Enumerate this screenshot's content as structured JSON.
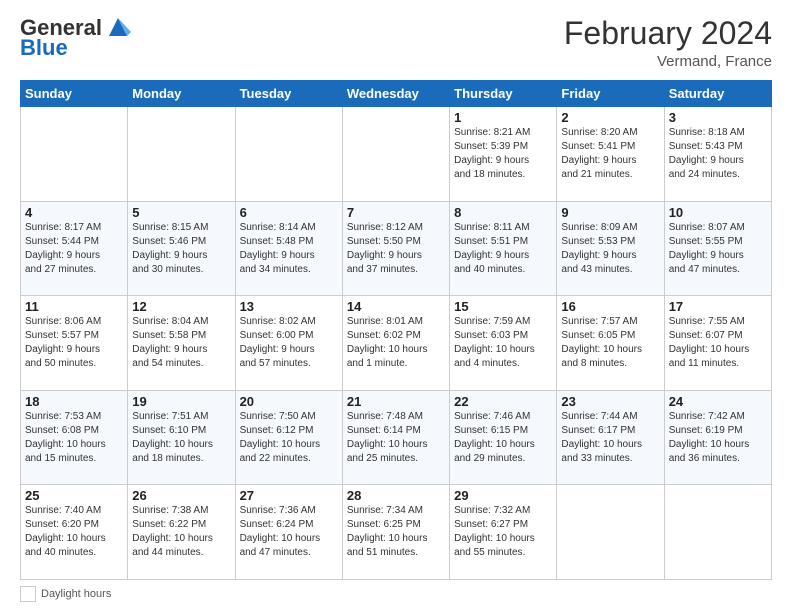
{
  "header": {
    "logo_line1": "General",
    "logo_line2": "Blue",
    "month_title": "February 2024",
    "location": "Vermand, France"
  },
  "days_of_week": [
    "Sunday",
    "Monday",
    "Tuesday",
    "Wednesday",
    "Thursday",
    "Friday",
    "Saturday"
  ],
  "legend_label": "Daylight hours",
  "weeks": [
    [
      {
        "day": "",
        "info": ""
      },
      {
        "day": "",
        "info": ""
      },
      {
        "day": "",
        "info": ""
      },
      {
        "day": "",
        "info": ""
      },
      {
        "day": "1",
        "info": "Sunrise: 8:21 AM\nSunset: 5:39 PM\nDaylight: 9 hours\nand 18 minutes."
      },
      {
        "day": "2",
        "info": "Sunrise: 8:20 AM\nSunset: 5:41 PM\nDaylight: 9 hours\nand 21 minutes."
      },
      {
        "day": "3",
        "info": "Sunrise: 8:18 AM\nSunset: 5:43 PM\nDaylight: 9 hours\nand 24 minutes."
      }
    ],
    [
      {
        "day": "4",
        "info": "Sunrise: 8:17 AM\nSunset: 5:44 PM\nDaylight: 9 hours\nand 27 minutes."
      },
      {
        "day": "5",
        "info": "Sunrise: 8:15 AM\nSunset: 5:46 PM\nDaylight: 9 hours\nand 30 minutes."
      },
      {
        "day": "6",
        "info": "Sunrise: 8:14 AM\nSunset: 5:48 PM\nDaylight: 9 hours\nand 34 minutes."
      },
      {
        "day": "7",
        "info": "Sunrise: 8:12 AM\nSunset: 5:50 PM\nDaylight: 9 hours\nand 37 minutes."
      },
      {
        "day": "8",
        "info": "Sunrise: 8:11 AM\nSunset: 5:51 PM\nDaylight: 9 hours\nand 40 minutes."
      },
      {
        "day": "9",
        "info": "Sunrise: 8:09 AM\nSunset: 5:53 PM\nDaylight: 9 hours\nand 43 minutes."
      },
      {
        "day": "10",
        "info": "Sunrise: 8:07 AM\nSunset: 5:55 PM\nDaylight: 9 hours\nand 47 minutes."
      }
    ],
    [
      {
        "day": "11",
        "info": "Sunrise: 8:06 AM\nSunset: 5:57 PM\nDaylight: 9 hours\nand 50 minutes."
      },
      {
        "day": "12",
        "info": "Sunrise: 8:04 AM\nSunset: 5:58 PM\nDaylight: 9 hours\nand 54 minutes."
      },
      {
        "day": "13",
        "info": "Sunrise: 8:02 AM\nSunset: 6:00 PM\nDaylight: 9 hours\nand 57 minutes."
      },
      {
        "day": "14",
        "info": "Sunrise: 8:01 AM\nSunset: 6:02 PM\nDaylight: 10 hours\nand 1 minute."
      },
      {
        "day": "15",
        "info": "Sunrise: 7:59 AM\nSunset: 6:03 PM\nDaylight: 10 hours\nand 4 minutes."
      },
      {
        "day": "16",
        "info": "Sunrise: 7:57 AM\nSunset: 6:05 PM\nDaylight: 10 hours\nand 8 minutes."
      },
      {
        "day": "17",
        "info": "Sunrise: 7:55 AM\nSunset: 6:07 PM\nDaylight: 10 hours\nand 11 minutes."
      }
    ],
    [
      {
        "day": "18",
        "info": "Sunrise: 7:53 AM\nSunset: 6:08 PM\nDaylight: 10 hours\nand 15 minutes."
      },
      {
        "day": "19",
        "info": "Sunrise: 7:51 AM\nSunset: 6:10 PM\nDaylight: 10 hours\nand 18 minutes."
      },
      {
        "day": "20",
        "info": "Sunrise: 7:50 AM\nSunset: 6:12 PM\nDaylight: 10 hours\nand 22 minutes."
      },
      {
        "day": "21",
        "info": "Sunrise: 7:48 AM\nSunset: 6:14 PM\nDaylight: 10 hours\nand 25 minutes."
      },
      {
        "day": "22",
        "info": "Sunrise: 7:46 AM\nSunset: 6:15 PM\nDaylight: 10 hours\nand 29 minutes."
      },
      {
        "day": "23",
        "info": "Sunrise: 7:44 AM\nSunset: 6:17 PM\nDaylight: 10 hours\nand 33 minutes."
      },
      {
        "day": "24",
        "info": "Sunrise: 7:42 AM\nSunset: 6:19 PM\nDaylight: 10 hours\nand 36 minutes."
      }
    ],
    [
      {
        "day": "25",
        "info": "Sunrise: 7:40 AM\nSunset: 6:20 PM\nDaylight: 10 hours\nand 40 minutes."
      },
      {
        "day": "26",
        "info": "Sunrise: 7:38 AM\nSunset: 6:22 PM\nDaylight: 10 hours\nand 44 minutes."
      },
      {
        "day": "27",
        "info": "Sunrise: 7:36 AM\nSunset: 6:24 PM\nDaylight: 10 hours\nand 47 minutes."
      },
      {
        "day": "28",
        "info": "Sunrise: 7:34 AM\nSunset: 6:25 PM\nDaylight: 10 hours\nand 51 minutes."
      },
      {
        "day": "29",
        "info": "Sunrise: 7:32 AM\nSunset: 6:27 PM\nDaylight: 10 hours\nand 55 minutes."
      },
      {
        "day": "",
        "info": ""
      },
      {
        "day": "",
        "info": ""
      }
    ]
  ]
}
